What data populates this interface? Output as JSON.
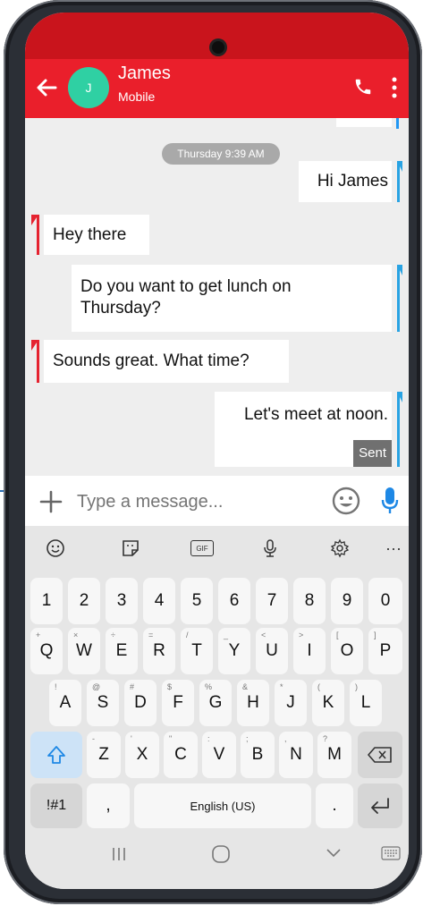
{
  "header": {
    "avatar_initial": "J",
    "name": "James",
    "subtitle": "Mobile"
  },
  "thread": {
    "date_label": "Thursday 9:39 AM",
    "messages": [
      {
        "dir": "out",
        "text": "Hi James"
      },
      {
        "dir": "in",
        "text": "Hey there"
      },
      {
        "dir": "out",
        "text": "Do you want to get lunch on Thursday?"
      },
      {
        "dir": "in",
        "text": "Sounds great. What time?"
      },
      {
        "dir": "out",
        "text": "Let's meet at noon.",
        "status": "Sent"
      }
    ]
  },
  "composer": {
    "placeholder": "Type a message..."
  },
  "keyboard": {
    "toolbar": [
      "emoji-icon",
      "sticker-icon",
      "gif-icon",
      "voice-icon",
      "settings-icon",
      "more-icon"
    ],
    "gif_label": "GIF",
    "more_label": "···",
    "row_numbers": [
      "1",
      "2",
      "3",
      "4",
      "5",
      "6",
      "7",
      "8",
      "9",
      "0"
    ],
    "row_q": [
      {
        "k": "Q",
        "s": "+"
      },
      {
        "k": "W",
        "s": "×"
      },
      {
        "k": "E",
        "s": "÷"
      },
      {
        "k": "R",
        "s": "="
      },
      {
        "k": "T",
        "s": "/"
      },
      {
        "k": "Y",
        "s": "_"
      },
      {
        "k": "U",
        "s": "<"
      },
      {
        "k": "I",
        "s": ">"
      },
      {
        "k": "O",
        "s": "["
      },
      {
        "k": "P",
        "s": "]"
      }
    ],
    "row_a": [
      {
        "k": "A",
        "s": "!"
      },
      {
        "k": "S",
        "s": "@"
      },
      {
        "k": "D",
        "s": "#"
      },
      {
        "k": "F",
        "s": "$"
      },
      {
        "k": "G",
        "s": "%"
      },
      {
        "k": "H",
        "s": "&"
      },
      {
        "k": "J",
        "s": "*"
      },
      {
        "k": "K",
        "s": "("
      },
      {
        "k": "L",
        "s": ")"
      }
    ],
    "row_z": [
      {
        "k": "Z",
        "s": "-"
      },
      {
        "k": "X",
        "s": "'"
      },
      {
        "k": "C",
        "s": "\""
      },
      {
        "k": "V",
        "s": ":"
      },
      {
        "k": "B",
        "s": ";"
      },
      {
        "k": "N",
        "s": ","
      },
      {
        "k": "M",
        "s": "?"
      }
    ],
    "symbols_label": "!#1",
    "comma_label": ",",
    "space_label": "English (US)",
    "period_label": "."
  },
  "colors": {
    "header": "#ea1f2b",
    "avatar": "#2fd0a3",
    "outgoing_accent": "#29a3e3",
    "incoming_accent": "#e52330",
    "mic": "#1e88e5"
  }
}
